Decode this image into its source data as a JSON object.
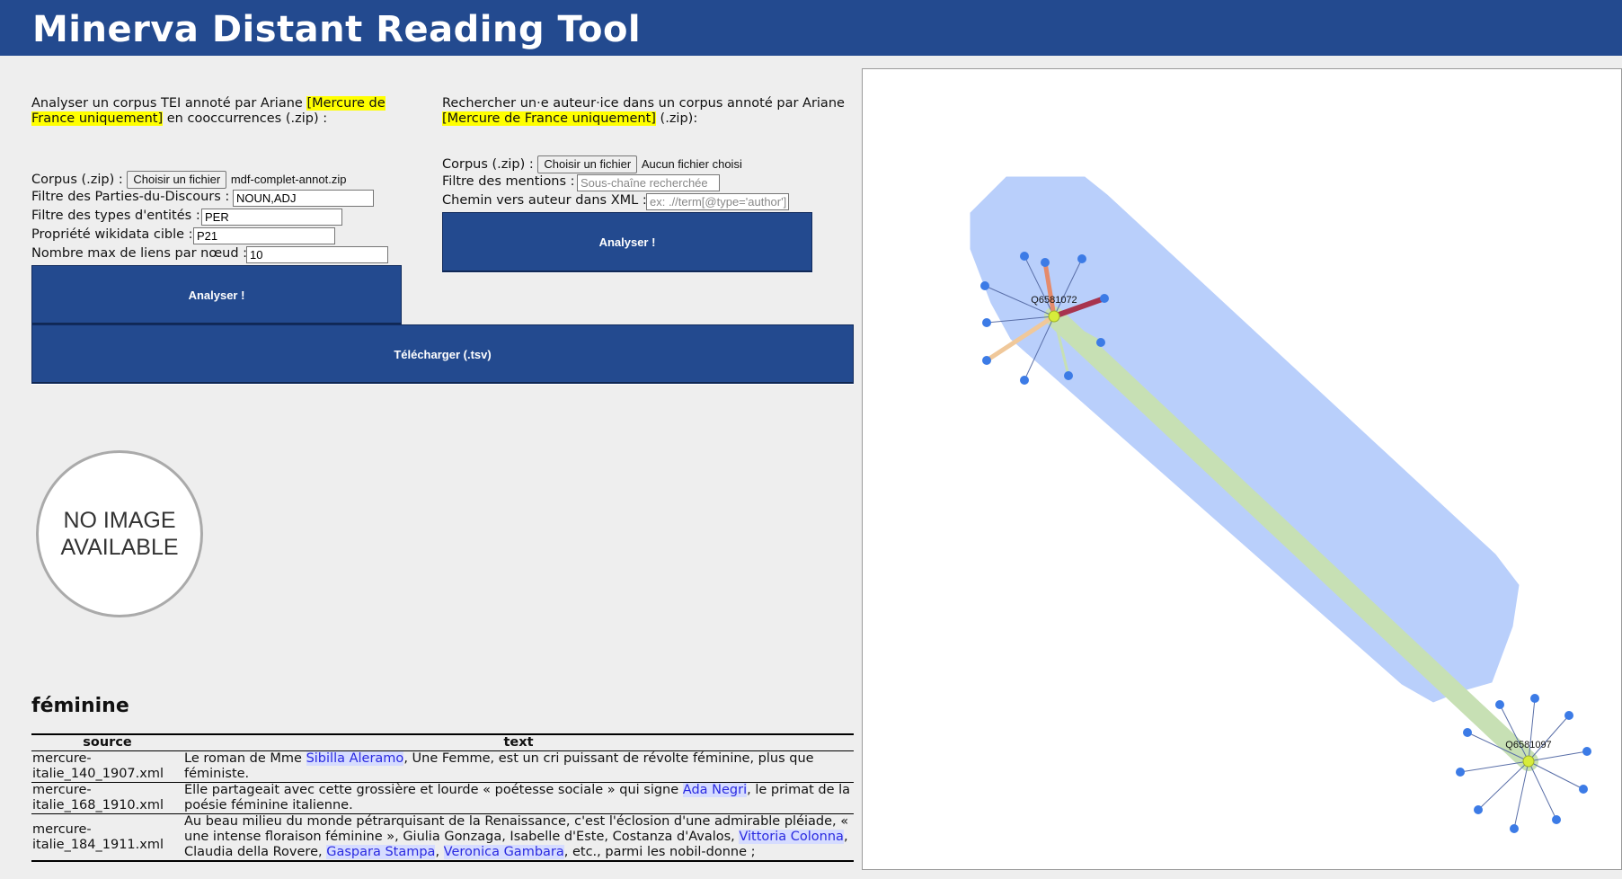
{
  "header": {
    "title": "Minerva Distant Reading Tool"
  },
  "cooc": {
    "intro_prefix": "Analyser un corpus TEI annoté par Ariane ",
    "intro_highlight": "[Mercure de France uniquement]",
    "intro_suffix": " en cooccurrences (.zip) :",
    "corpus_label": "Corpus (.zip) :",
    "file_button": "Choisir un fichier",
    "file_name": "mdf-complet-annot.zip",
    "pos_label": "Filtre des Parties-du-Discours :",
    "pos_value": "NOUN,ADJ",
    "entity_label": "Filtre des types d'entités :",
    "entity_value": "PER",
    "prop_label": "Propriété wikidata cible :",
    "prop_value": "P21",
    "maxlinks_label": "Nombre max de liens par nœud :",
    "maxlinks_value": "10",
    "analyze_button": "Analyser !",
    "download_button": "Télécharger (.tsv)"
  },
  "author": {
    "intro_prefix": "Rechercher un·e auteur·ice dans un corpus annoté par Ariane ",
    "intro_highlight": "[Mercure de France uniquement]",
    "intro_suffix": " (.zip):",
    "corpus_label": "Corpus (.zip) :",
    "file_button": "Choisir un fichier",
    "file_name": "Aucun fichier choisi",
    "mentions_label": "Filtre des mentions :",
    "mentions_placeholder": "Sous-chaîne recherchée",
    "path_label": "Chemin vers auteur dans XML :",
    "path_placeholder": "ex: .//term[@type='author']",
    "analyze_button": "Analyser !"
  },
  "noimage": {
    "line1": "NO IMAGE",
    "line2": "AVAILABLE"
  },
  "section": {
    "title": "féminine"
  },
  "table": {
    "headers": {
      "source": "source",
      "text": "text"
    },
    "rows": [
      {
        "source": "mercure-italie_140_1907.xml",
        "parts": {
          "a": "Le roman de Mme ",
          "e1": "Sibilla Aleramo",
          "b": ", Une Femme, est un cri puissant de révolte féminine, plus que féministe."
        }
      },
      {
        "source": "mercure-italie_168_1910.xml",
        "parts": {
          "a": "Elle partageait avec cette grossière et lourde « poétesse sociale » qui signe ",
          "e1": "Ada Negri",
          "b": ", le primat de la poésie féminine italienne."
        }
      },
      {
        "source": "mercure-italie_184_1911.xml",
        "parts": {
          "a": "Au beau milieu du monde pétrarquisant de la Renaissance, c'est l'éclosion d'une admirable pléiade, « une intense floraison féminine », Giulia Gonzaga, Isabelle d'Este, Costanza d'Avalos, ",
          "e1": "Vittoria Colonna",
          "b": ", Claudia della Rovere, ",
          "e2": "Gaspara Stampa",
          "c": ", ",
          "e3": "Veronica Gambara",
          "d": ", etc., parmi les nobil-donne ;"
        }
      }
    ]
  },
  "graph": {
    "nodes": [
      {
        "id": "Q6581072",
        "label": "Q6581072",
        "color": "#d7ec3a"
      },
      {
        "id": "Q6581097",
        "label": "Q6581097",
        "color": "#d7ec3a"
      }
    ],
    "hull_color": "#b9cffb",
    "leaf_color": "#3c7be6",
    "bridge_color": "#c7e0b4",
    "edge_colors": [
      "#a8344e",
      "#e58b6c",
      "#f0c89a"
    ]
  }
}
